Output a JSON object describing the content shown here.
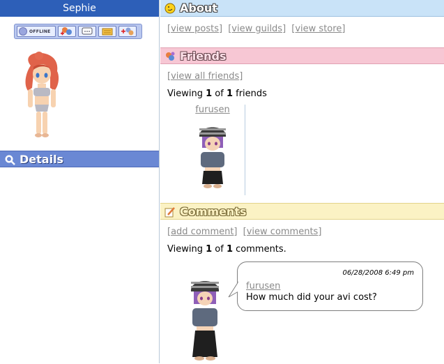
{
  "profile": {
    "username": "Sephie",
    "status": {
      "label": "OFFLINE",
      "icons": [
        "add-friend-icon",
        "chat-icon",
        "message-icon",
        "trade-icon"
      ]
    },
    "details_label": "Details"
  },
  "about": {
    "title": "About",
    "links": [
      "[view posts]",
      "[view guilds]",
      "[view store]"
    ]
  },
  "friends": {
    "title": "Friends",
    "view_all_link": "[view all friends]",
    "viewing": {
      "prefix": "Viewing",
      "current": "1",
      "of": "of",
      "total": "1",
      "suffix": "friends"
    },
    "list": [
      {
        "name": "furusen"
      }
    ]
  },
  "comments": {
    "title": "Comments",
    "links": [
      "[add comment]",
      "[view comments]"
    ],
    "viewing": {
      "prefix": "Viewing",
      "current": "1",
      "of": "of",
      "total": "1",
      "suffix": "comments."
    },
    "items": [
      {
        "author": "furusen",
        "date": "06/28/2008 6:49 pm",
        "text": "How much did your avi cost?"
      }
    ]
  },
  "colors": {
    "username_bar": "#2d5fb8",
    "details_bar": "#6a88d4",
    "about_bar": "#c9e3f8",
    "friends_bar": "#f7c7d4",
    "comments_bar": "#fbf2c4",
    "link_gray": "#8a8a8a"
  }
}
